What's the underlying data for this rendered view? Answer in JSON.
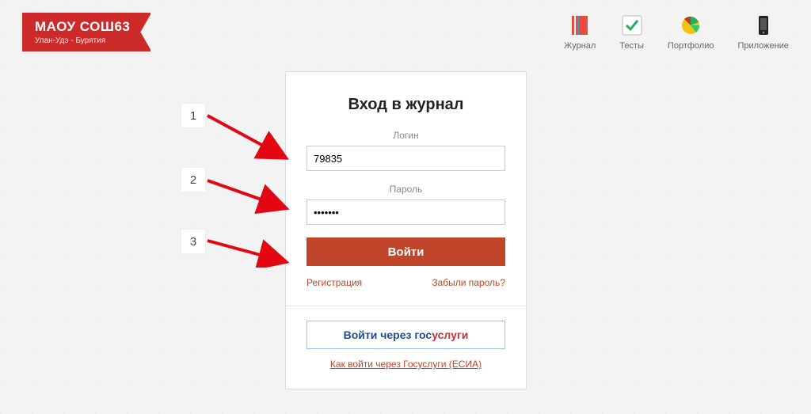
{
  "ribbon": {
    "title": "МАОУ СОШ63",
    "subtitle": "Улан-Удэ - Бурятия"
  },
  "topnav": {
    "journal": "Журнал",
    "tests": "Тесты",
    "portfolio": "Портфолио",
    "app": "Приложение"
  },
  "login": {
    "heading": "Вход в журнал",
    "login_label": "Логин",
    "login_value": "79835",
    "password_label": "Пароль",
    "password_value": "•••••••",
    "submit": "Войти",
    "register": "Регистрация",
    "forgot": "Забыли пароль?",
    "gosuslugi_prefix": "Войти через ",
    "gosuslugi_blue": "гос",
    "gosuslugi_red": "услуги",
    "gosuslugi_help": "Как войти через Госуслуги (ЕСИА)"
  },
  "annotations": {
    "n1": "1",
    "n2": "2",
    "n3": "3"
  }
}
